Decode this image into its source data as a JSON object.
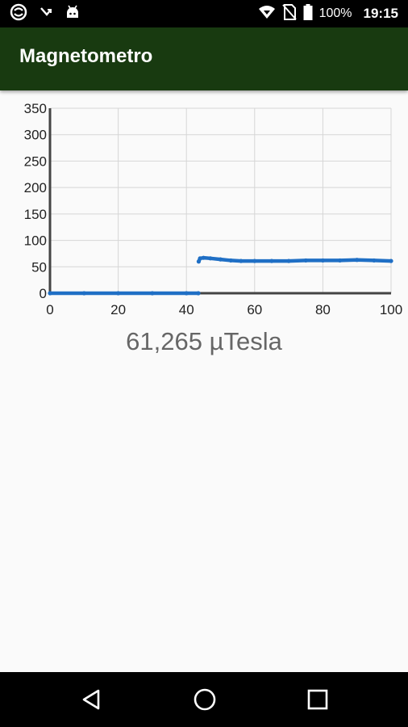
{
  "status_bar": {
    "icons_left": [
      "sync-icon",
      "missed-call-icon",
      "android-icon"
    ],
    "icons_right": [
      "wifi-icon",
      "no-sim-icon",
      "battery-icon"
    ],
    "battery": "100%",
    "time": "19:15"
  },
  "app_bar": {
    "title": "Magnetometro",
    "color": "#183a10"
  },
  "chart_data": {
    "type": "line",
    "xlim": [
      0,
      100
    ],
    "ylim": [
      0,
      350
    ],
    "x_ticks": [
      "0",
      "20",
      "40",
      "60",
      "80",
      "100"
    ],
    "y_ticks": [
      "0",
      "50",
      "100",
      "150",
      "200",
      "250",
      "300",
      "350"
    ],
    "grid": true,
    "series": [
      {
        "color": "#1f6fc5",
        "x": [
          0,
          10,
          20,
          30,
          40,
          43.5,
          43.6,
          44,
          45,
          47,
          50,
          53,
          56,
          60,
          65,
          70,
          75,
          80,
          85,
          90,
          95,
          100
        ],
        "y": [
          0,
          0,
          0,
          0,
          0,
          0,
          60,
          66,
          67,
          66,
          64,
          62,
          61,
          61,
          61,
          61,
          62,
          62,
          62,
          63,
          62,
          61
        ]
      }
    ]
  },
  "readout": {
    "value": "61,265 µTesla"
  },
  "nav_bar": {
    "icons": [
      "back-icon",
      "home-icon",
      "recents-icon"
    ]
  }
}
